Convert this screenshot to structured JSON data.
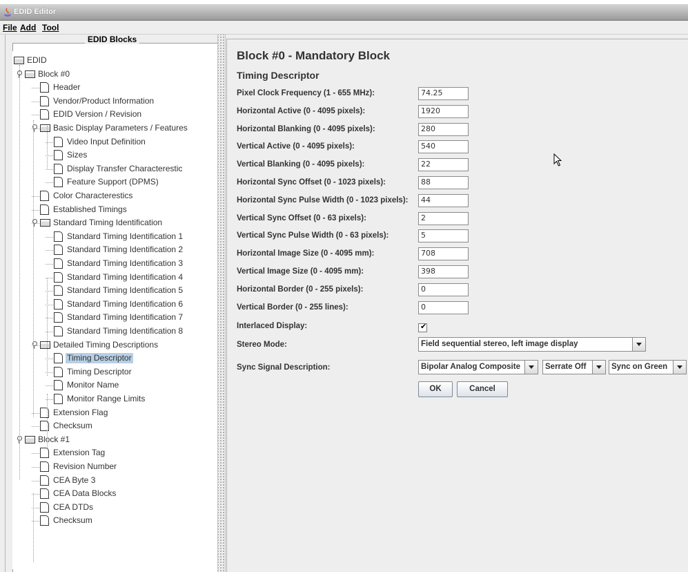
{
  "window": {
    "title": "EDID Editor"
  },
  "menu": [
    {
      "label": "File"
    },
    {
      "label": "Add"
    },
    {
      "label": "Tool"
    }
  ],
  "tree": {
    "legend": "EDID Blocks",
    "nodes": [
      {
        "label": "EDID",
        "type": "folder",
        "level": 0
      },
      {
        "label": "Block #0",
        "type": "folder",
        "level": 1,
        "expanded": true
      },
      {
        "label": "Header",
        "type": "doc",
        "level": 2
      },
      {
        "label": "Vendor/Product Information",
        "type": "doc",
        "level": 2
      },
      {
        "label": "EDID Version / Revision",
        "type": "doc",
        "level": 2
      },
      {
        "label": "Basic Display Parameters / Features",
        "type": "folder",
        "level": 2,
        "expanded": true
      },
      {
        "label": "Video Input Definition",
        "type": "doc",
        "level": 3
      },
      {
        "label": "Sizes",
        "type": "doc",
        "level": 3
      },
      {
        "label": "Display Transfer Characterestic",
        "type": "doc",
        "level": 3
      },
      {
        "label": "Feature Support (DPMS)",
        "type": "doc",
        "level": 3
      },
      {
        "label": "Color Characterestics",
        "type": "doc",
        "level": 2
      },
      {
        "label": "Established Timings",
        "type": "doc",
        "level": 2
      },
      {
        "label": "Standard Timing Identification",
        "type": "folder",
        "level": 2,
        "expanded": true
      },
      {
        "label": "Standard Timing Identification 1",
        "type": "doc",
        "level": 3
      },
      {
        "label": "Standard Timing Identification 2",
        "type": "doc",
        "level": 3
      },
      {
        "label": "Standard Timing Identification 3",
        "type": "doc",
        "level": 3
      },
      {
        "label": "Standard Timing Identification 4",
        "type": "doc",
        "level": 3
      },
      {
        "label": "Standard Timing Identification 5",
        "type": "doc",
        "level": 3
      },
      {
        "label": "Standard Timing Identification 6",
        "type": "doc",
        "level": 3
      },
      {
        "label": "Standard Timing Identification 7",
        "type": "doc",
        "level": 3
      },
      {
        "label": "Standard Timing Identification 8",
        "type": "doc",
        "level": 3
      },
      {
        "label": "Detailed Timing Descriptions",
        "type": "folder",
        "level": 2,
        "expanded": true
      },
      {
        "label": "Timing Descriptor",
        "type": "doc",
        "level": 3,
        "selected": true
      },
      {
        "label": "Timing Descriptor",
        "type": "doc",
        "level": 3
      },
      {
        "label": "Monitor Name",
        "type": "doc",
        "level": 3
      },
      {
        "label": "Monitor Range Limits",
        "type": "doc",
        "level": 3
      },
      {
        "label": "Extension Flag",
        "type": "doc",
        "level": 2
      },
      {
        "label": "Checksum",
        "type": "doc",
        "level": 2
      },
      {
        "label": "Block #1",
        "type": "folder",
        "level": 1,
        "expanded": true
      },
      {
        "label": "Extension Tag",
        "type": "doc",
        "level": 2
      },
      {
        "label": "Revision Number",
        "type": "doc",
        "level": 2
      },
      {
        "label": "CEA Byte 3",
        "type": "doc",
        "level": 2
      },
      {
        "label": "CEA Data Blocks",
        "type": "doc",
        "level": 2
      },
      {
        "label": "CEA DTDs",
        "type": "doc",
        "level": 2
      },
      {
        "label": "Checksum",
        "type": "doc",
        "level": 2
      }
    ]
  },
  "detail": {
    "block_title": "Block #0 - Mandatory Block",
    "section_title": "Timing Descriptor",
    "fields": [
      {
        "label": "Pixel Clock Frequency (1 - 655 MHz):",
        "value": "74.25"
      },
      {
        "label": "Horizontal Active (0 - 4095 pixels):",
        "value": "1920"
      },
      {
        "label": "Horizontal Blanking (0 - 4095 pixels):",
        "value": "280"
      },
      {
        "label": "Vertical Active (0 - 4095 pixels):",
        "value": "540"
      },
      {
        "label": "Vertical Blanking (0 - 4095 pixels):",
        "value": "22"
      },
      {
        "label": "Horizontal Sync Offset (0 - 1023 pixels):",
        "value": "88"
      },
      {
        "label": "Horizontal Sync Pulse Width (0 - 1023 pixels):",
        "value": "44"
      },
      {
        "label": "Vertical Sync Offset (0 - 63 pixels):",
        "value": "2"
      },
      {
        "label": "Vertical Sync Pulse Width (0 - 63 pixels):",
        "value": "5"
      },
      {
        "label": "Horizontal Image Size (0 - 4095 mm):",
        "value": "708"
      },
      {
        "label": "Vertical Image Size (0 - 4095 mm):",
        "value": "398"
      },
      {
        "label": "Horizontal Border (0 - 255 pixels):",
        "value": "0"
      },
      {
        "label": "Vertical Border (0 - 255 lines):",
        "value": "0"
      }
    ],
    "interlaced": {
      "label": "Interlaced Display:",
      "checked": true,
      "mark": "✔"
    },
    "stereo": {
      "label": "Stereo Mode:",
      "value": "Field sequential stereo, left image display"
    },
    "sync": {
      "label": "Sync Signal Description:",
      "type_value": "Bipolar Analog Composite",
      "serrate_value": "Serrate Off",
      "green_value": "Sync on Green"
    },
    "buttons": {
      "ok": "OK",
      "cancel": "Cancel"
    }
  }
}
